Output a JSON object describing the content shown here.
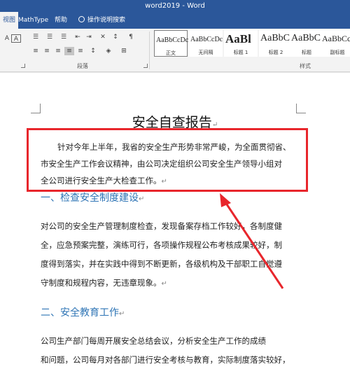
{
  "window": {
    "title": "word2019 - Word"
  },
  "tabs": [
    {
      "label": "视图",
      "active": true
    },
    {
      "label": "MathType"
    },
    {
      "label": "帮助"
    },
    {
      "label": "操作说明搜索"
    }
  ],
  "ribbon": {
    "groups": {
      "paragraph": "段落",
      "styles": "样式"
    },
    "styles": [
      {
        "sample": "AaBbCcDc",
        "name": "正文"
      },
      {
        "sample": "AaBbCcDc",
        "name": "无间隔"
      },
      {
        "sample": "AaBl",
        "name": "标题 1"
      },
      {
        "sample": "AaBbC",
        "name": "标题 2"
      },
      {
        "sample": "AaBbC",
        "name": "标题"
      },
      {
        "sample": "AaBbCc",
        "name": "副标题"
      }
    ]
  },
  "document": {
    "title": "安全自查报告",
    "para1_lines": [
      "针对今年上半年，我省的安全生产形势非常严峻，为全面贯彻省、",
      "市安全生产工作会议精神，由公司决定组织公司安全生产领导小组对",
      "全公司进行安全生产大检查工作。"
    ],
    "heading1": "一、检查安全制度建设",
    "para2_lines": [
      "对公司的安全生产管理制度检查，发现备案存档工作较好，各制度健",
      "全，应急预案完整，演练可行，各项操作规程公布考核成果较好，制",
      "度得到落实，并在实践中得到不断更新，各级机构及干部职工自觉遵",
      "守制度和规程内容，无违章现象。"
    ],
    "heading2": "二、安全教育工作",
    "para3_lines": [
      "公司生产部门每周开展安全总结会议，分析安全生产工作的成绩",
      "和问题，公司每月对各部门进行安全考核与教育，实际制度落实较好，"
    ],
    "paragraph_mark": "↵"
  },
  "colors": {
    "ribbon_blue": "#2b579a",
    "heading_blue": "#2e74b5",
    "annotation_red": "#e8262c"
  }
}
